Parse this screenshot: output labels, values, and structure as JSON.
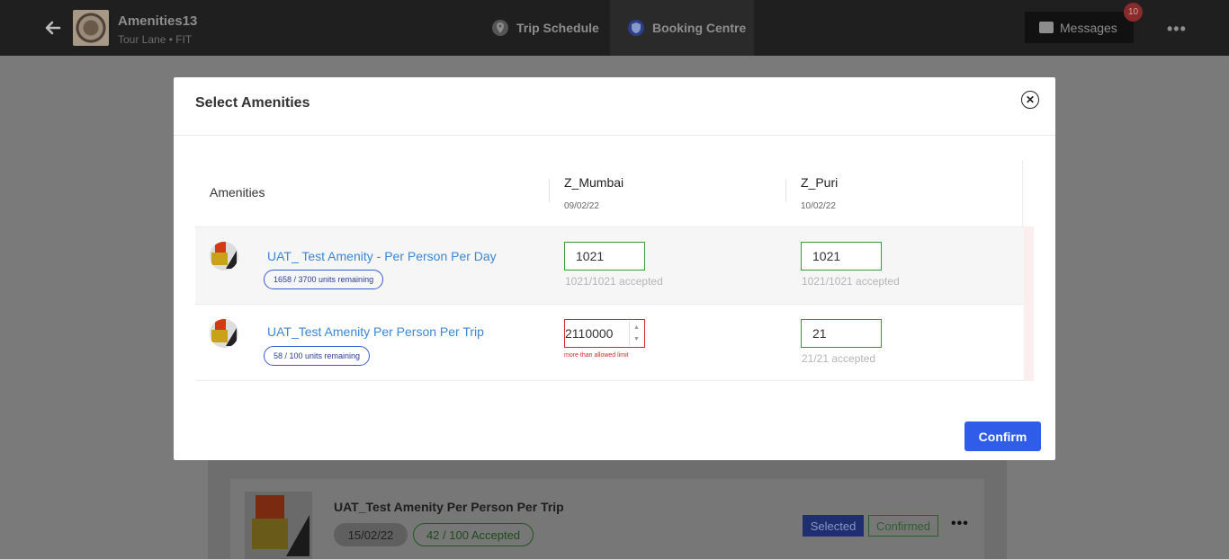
{
  "header": {
    "trip_title": "Amenities13",
    "trip_subtitle": "Tour Lane • FIT",
    "tabs": [
      {
        "label": "Trip Schedule",
        "active": false
      },
      {
        "label": "Booking Centre",
        "active": true
      }
    ],
    "messages_label": "Messages",
    "messages_count": "10"
  },
  "modal": {
    "title": "Select Amenities",
    "column_header": "Amenities",
    "locations": [
      {
        "city": "Z_Mumbai",
        "date": "09/02/22"
      },
      {
        "city": "Z_Puri",
        "date": "10/02/22"
      }
    ],
    "rows": [
      {
        "name": "UAT_ Test Amenity - Per Person Per Day",
        "units": "1658 / 3700 units remaining",
        "qty": [
          {
            "value": "1021",
            "accepted": "1021/1021 accepted"
          },
          {
            "value": "1021",
            "accepted": "1021/1021 accepted"
          }
        ]
      },
      {
        "name": "UAT_Test Amenity Per Person Per Trip",
        "units": "58 / 100 units remaining",
        "qty": [
          {
            "value": "2110000",
            "error": "more than allowed limit"
          },
          {
            "value": "21",
            "accepted": "21/21 accepted"
          }
        ]
      }
    ],
    "confirm_label": "Confirm"
  },
  "background_card": {
    "title": "UAT_Test Amenity Per Person Per Trip",
    "date": "15/02/22",
    "accepted": "42 / 100 Accepted",
    "selected_label": "Selected",
    "confirmed_label": "Confirmed"
  },
  "colors": {
    "accent": "#2f5ce9",
    "link": "#3a87d6",
    "valid_border": "#3a9a3a",
    "error": "#d42a2a"
  },
  "icons": [
    "back-arrow-icon",
    "location-pin-icon",
    "shield-icon",
    "chat-icon",
    "more-icon",
    "close-icon"
  ]
}
